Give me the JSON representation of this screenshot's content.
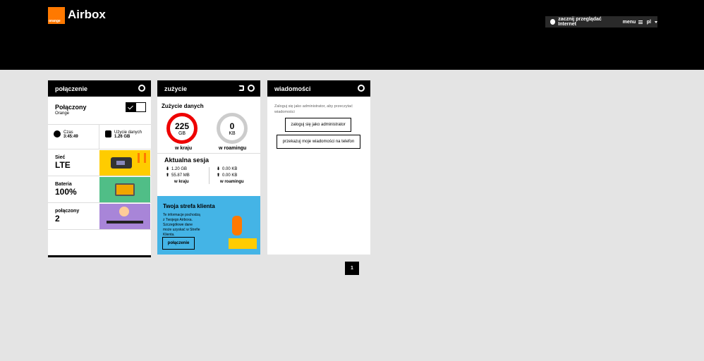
{
  "header": {
    "logo_text": "orange",
    "brand": "Airbox",
    "nav": {
      "browse": "zacznij przeglądać Internet",
      "menu": "menu",
      "lang": "pl"
    }
  },
  "connection_card": {
    "title": "połączenie",
    "status": "Połączony",
    "operator": "Orange",
    "time_label": "Czas",
    "time_value": "3:45:49",
    "usage_label": "Użycie danych",
    "usage_value": "1.26 GB",
    "network_label": "Sieć",
    "network_value": "LTE",
    "battery_label": "Bateria",
    "battery_value": "100%",
    "connected_label": "połączony",
    "connected_value": "2"
  },
  "usage_card": {
    "title": "zużycie",
    "subtitle": "Zużycie danych",
    "home_value": "225",
    "home_unit": "GB",
    "home_label": "w kraju",
    "roaming_value": "0",
    "roaming_unit": "KB",
    "roaming_label": "w roamingu",
    "session_title": "Aktualna sesja",
    "home_down": "1.20 GB",
    "home_up": "55.87 MB",
    "roam_down": "0.00 KB",
    "roam_up": "0.00 KB",
    "session_home_label": "w kraju",
    "session_roaming_label": "w roamingu",
    "promo_title": "Twoja strefa klienta",
    "promo_text": "Te informacje pochodzą z Twojego Airboxa. Szczegółowe dane może uzyskać w Strefie Klienta.",
    "promo_button": "połączenie"
  },
  "messages_card": {
    "title": "wiadomości",
    "info": "Zaloguj się jako administrator, aby przeczytać wiadomości",
    "login_button": "zaloguj się jako administrator",
    "forward_button": "przekazuj moje wiadomości na telefon"
  },
  "pager": {
    "page": "1"
  },
  "colors": {
    "accent": "#ff7900",
    "ring": "#e00000",
    "promo": "#44b4e6"
  }
}
